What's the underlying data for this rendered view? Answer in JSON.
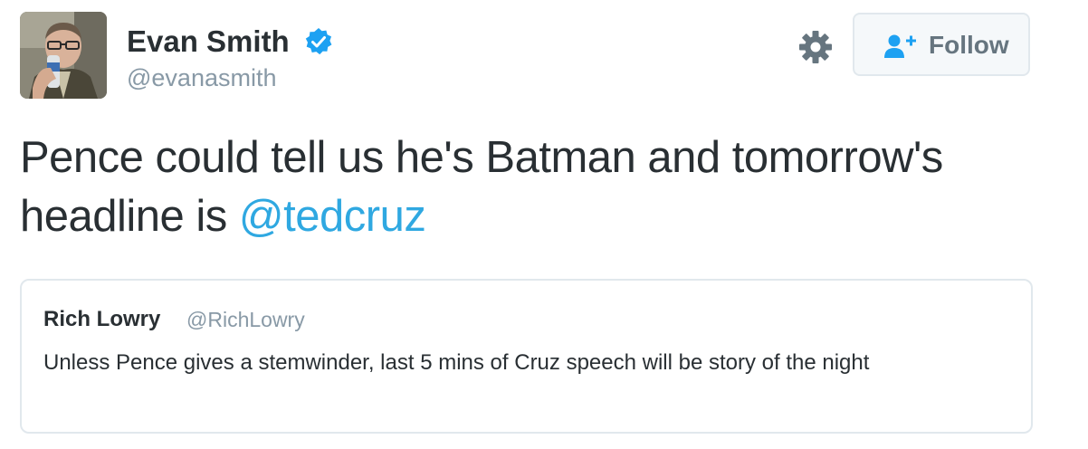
{
  "tweet": {
    "author": {
      "name": "Evan Smith",
      "handle": "@evanasmith",
      "verified_icon": "verified-badge-icon",
      "avatar_icon": "profile-photo"
    },
    "actions": {
      "settings_icon": "gear-icon",
      "follow_icon": "add-user-icon",
      "follow_label": "Follow"
    },
    "text": {
      "body": "Pence could tell us he's Batman and tomorrow's headline is ",
      "mention": "@tedcruz"
    },
    "quoted_tweet": {
      "name": "Rich Lowry",
      "handle": "@RichLowry",
      "text": "Unless Pence gives a stemwinder, last 5 mins of Cruz speech will be story of the night"
    },
    "colors": {
      "text": "#292f33",
      "secondary": "#8899a6",
      "link": "#2fa8e1",
      "verified": "#1da1f2",
      "border": "#e1e8ed",
      "button_bg": "#f5f8fa",
      "button_text": "#66757f"
    }
  }
}
